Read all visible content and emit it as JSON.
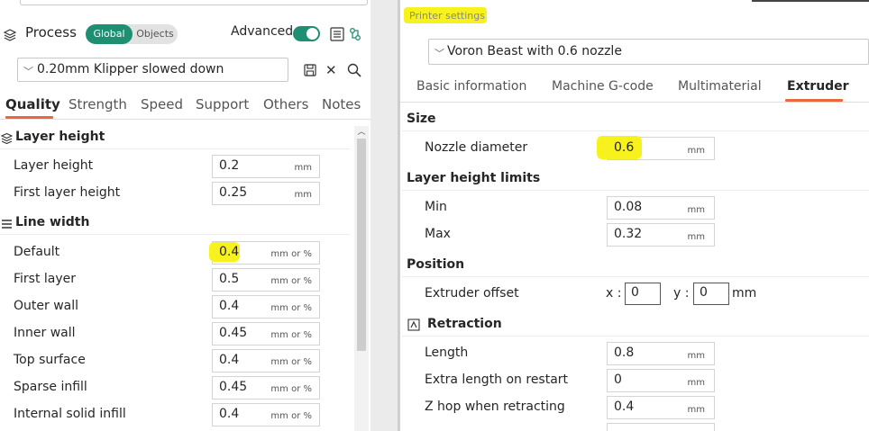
{
  "process": {
    "title": "Process",
    "toggle_global": "Global",
    "toggle_objects": "Objects",
    "advanced_label": "Advanced",
    "advanced_on": true,
    "preset_name": "0.20mm Klipper slowed down",
    "tabs": [
      "Quality",
      "Strength",
      "Speed",
      "Support",
      "Others",
      "Notes"
    ],
    "active_tab": "Quality",
    "sections": {
      "layer_height": {
        "title": "Layer height",
        "rows": [
          {
            "label": "Layer height",
            "value": "0.2",
            "unit": "mm"
          },
          {
            "label": "First layer height",
            "value": "0.25",
            "unit": "mm"
          }
        ]
      },
      "line_width": {
        "title": "Line width",
        "rows": [
          {
            "label": "Default",
            "value": "0.4",
            "unit": "mm or %"
          },
          {
            "label": "First layer",
            "value": "0.5",
            "unit": "mm or %"
          },
          {
            "label": "Outer wall",
            "value": "0.4",
            "unit": "mm or %"
          },
          {
            "label": "Inner wall",
            "value": "0.45",
            "unit": "mm or %"
          },
          {
            "label": "Top surface",
            "value": "0.4",
            "unit": "mm or %"
          },
          {
            "label": "Sparse infill",
            "value": "0.45",
            "unit": "mm or %"
          },
          {
            "label": "Internal solid infill",
            "value": "0.4",
            "unit": "mm or %"
          }
        ]
      }
    }
  },
  "printer": {
    "title": "Printer settings",
    "preset_name": "Voron Beast with 0.6 nozzle",
    "tabs": [
      "Basic information",
      "Machine G-code",
      "Multimaterial",
      "Extruder"
    ],
    "active_tab": "Extruder",
    "sections": {
      "size": {
        "title": "Size",
        "rows": [
          {
            "label": "Nozzle diameter",
            "value": "0.6",
            "unit": "mm"
          }
        ]
      },
      "layer_limits": {
        "title": "Layer height limits",
        "rows": [
          {
            "label": "Min",
            "value": "0.08",
            "unit": "mm"
          },
          {
            "label": "Max",
            "value": "0.32",
            "unit": "mm"
          }
        ]
      },
      "position": {
        "title": "Position",
        "extruder_offset": {
          "label": "Extruder offset",
          "x_label": "x :",
          "x_value": "0",
          "y_label": "y :",
          "y_value": "0",
          "unit": "mm"
        }
      },
      "retraction": {
        "title": "Retraction",
        "rows": [
          {
            "label": "Length",
            "value": "0.8",
            "unit": "mm"
          },
          {
            "label": "Extra length on restart",
            "value": "0",
            "unit": "mm"
          },
          {
            "label": "Z hop when retracting",
            "value": "0.4",
            "unit": "mm"
          }
        ]
      }
    }
  },
  "colors": {
    "accent_teal": "#1f8f74",
    "tab_underline": "#e86a3a",
    "highlight_yellow": "#f7f21e"
  },
  "icons": {
    "process": "layers-icon",
    "list": "list-icon",
    "compare": "compare-icon",
    "save": "save-icon",
    "close": "close-icon",
    "search": "search-icon",
    "section": "layers-section-icon",
    "retraction": "retraction-icon"
  }
}
